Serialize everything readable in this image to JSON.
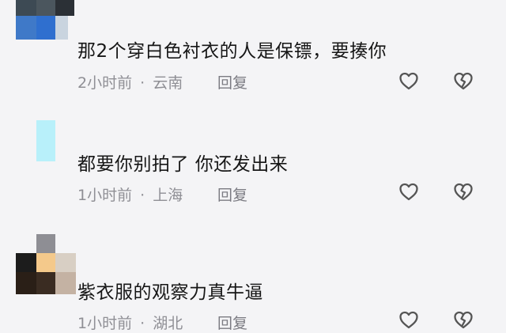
{
  "comments": [
    {
      "text": "那2个穿白色衬衣的人是保镖，要揍你",
      "time": "2小时前",
      "separator": "·",
      "location": "云南",
      "reply_label": "回复",
      "like_icon": "heart-outline-icon",
      "dislike_icon": "broken-heart-icon"
    },
    {
      "text": "都要你别拍了 你还发出来",
      "time": "1小时前",
      "separator": "·",
      "location": "上海",
      "reply_label": "回复",
      "like_icon": "heart-outline-icon",
      "dislike_icon": "broken-heart-icon"
    },
    {
      "text": "紫衣服的观察力真牛逼",
      "time": "1小时前",
      "separator": "·",
      "location": "湖北",
      "reply_label": "回复",
      "like_icon": "heart-outline-icon",
      "dislike_icon": "broken-heart-icon"
    }
  ],
  "colors": {
    "background": "#f4f4f6",
    "text": "#161616",
    "meta": "#8f8f95",
    "icon": "#555555"
  }
}
